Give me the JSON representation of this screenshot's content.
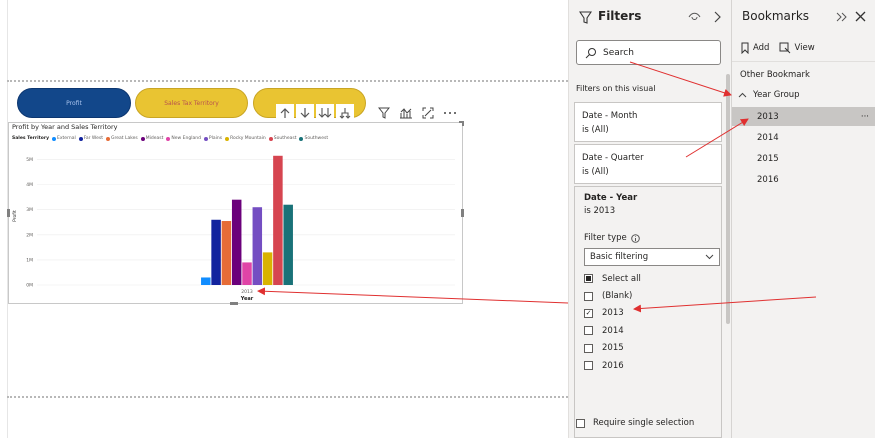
{
  "report": {
    "buttons": {
      "profit": "Profit",
      "sales_tax": "Sales Tax Territory",
      "third": ""
    },
    "chart": {
      "title": "Profit by Year and Sales Territory",
      "legend_title": "Sales Territory",
      "legend": [
        {
          "name": "External",
          "color": "#118dff"
        },
        {
          "name": "Far West",
          "color": "#12239e"
        },
        {
          "name": "Great Lakes",
          "color": "#e66c37"
        },
        {
          "name": "Mideast",
          "color": "#6b007b"
        },
        {
          "name": "New England",
          "color": "#e044a7"
        },
        {
          "name": "Plains",
          "color": "#744ec2"
        },
        {
          "name": "Rocky Mountain",
          "color": "#d9b300"
        },
        {
          "name": "Southeast",
          "color": "#d64550"
        },
        {
          "name": "Southwest",
          "color": "#197278"
        }
      ]
    }
  },
  "chart_data": {
    "type": "bar",
    "title": "Profit by Year and Sales Territory",
    "xlabel": "Year",
    "ylabel": "Profit",
    "categories": [
      "2013"
    ],
    "yticks": [
      "0M",
      "1M",
      "2M",
      "3M",
      "4M",
      "5M"
    ],
    "ylim": [
      0,
      5.5
    ],
    "series": [
      {
        "name": "External",
        "values": [
          0.3
        ]
      },
      {
        "name": "Far West",
        "values": [
          2.6
        ]
      },
      {
        "name": "Great Lakes",
        "values": [
          2.55
        ]
      },
      {
        "name": "Mideast",
        "values": [
          3.4
        ]
      },
      {
        "name": "New England",
        "values": [
          0.9
        ]
      },
      {
        "name": "Plains",
        "values": [
          3.1
        ]
      },
      {
        "name": "Rocky Mountain",
        "values": [
          1.3
        ]
      },
      {
        "name": "Southeast",
        "values": [
          5.15
        ]
      },
      {
        "name": "Southwest",
        "values": [
          3.2
        ]
      }
    ],
    "grid": true,
    "legend_position": "top-left"
  },
  "filters": {
    "title": "Filters",
    "search_placeholder": "Search",
    "section": "Filters on this visual",
    "cards": [
      {
        "field": "Date - Month",
        "value": "is (All)"
      },
      {
        "field": "Date - Quarter",
        "value": "is (All)"
      }
    ],
    "year": {
      "field": "Date - Year",
      "value": "is 2013",
      "filter_type_label": "Filter type",
      "filter_type": "Basic filtering",
      "options": [
        {
          "label": "Select all",
          "state": "mixed"
        },
        {
          "label": "(Blank)",
          "state": "off"
        },
        {
          "label": "2013",
          "state": "on"
        },
        {
          "label": "2014",
          "state": "off"
        },
        {
          "label": "2015",
          "state": "off"
        },
        {
          "label": "2016",
          "state": "off"
        }
      ],
      "require_single": "Require single selection"
    }
  },
  "bookmarks": {
    "title": "Bookmarks",
    "add": "Add",
    "view": "View",
    "other": "Other Bookmark",
    "group": "Year Group",
    "items": [
      "2013",
      "2014",
      "2015",
      "2016"
    ],
    "more": "···"
  },
  "colors": {
    "accent_arrow": "#e03030",
    "panel_bg": "#f3f2f1"
  }
}
